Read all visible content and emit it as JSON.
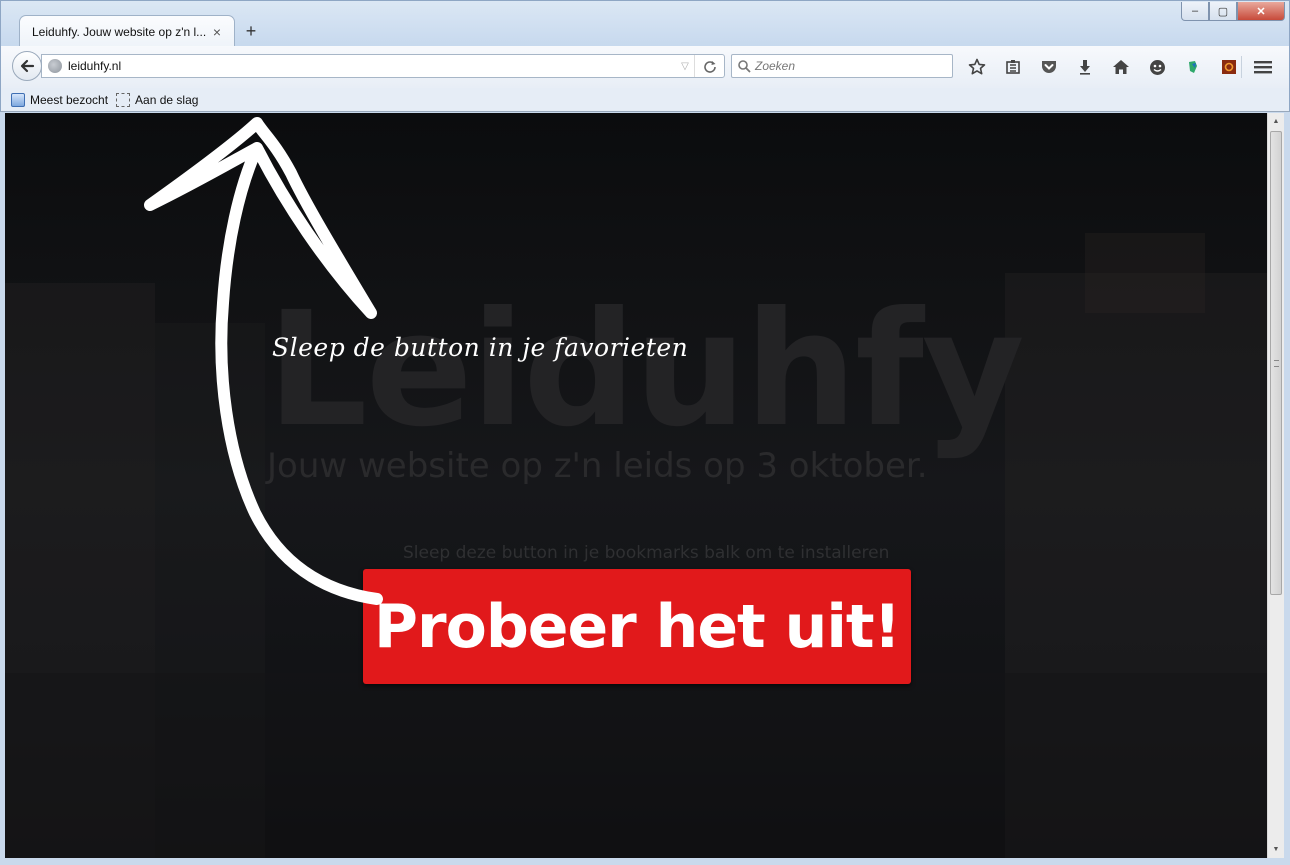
{
  "window": {
    "tab_title": "Leiduhfy. Jouw website op z'n l...",
    "tab_close": "×",
    "new_tab": "+",
    "controls": {
      "minimize": "‒",
      "maximize": "▢",
      "close": "✕"
    }
  },
  "navbar": {
    "url": "leiduhfy.nl",
    "url_dropdown": "▽",
    "search_placeholder": "Zoeken",
    "icons": [
      "bookmark-star-icon",
      "reading-list-icon",
      "pocket-icon",
      "download-icon",
      "home-icon",
      "emoji-icon",
      "extension-green-icon",
      "extension-orange-icon",
      "hamburger-menu-icon"
    ]
  },
  "bookmarks": {
    "items": [
      {
        "label": "Meest bezocht",
        "icon": "most-visited-icon"
      },
      {
        "label": "Aan de slag",
        "icon": "getting-started-icon"
      }
    ]
  },
  "page": {
    "logo": "Leiduhfy",
    "tagline": "Jouw website op z'n leids op 3 oktober.",
    "instruction": "Sleep deze button in je bookmarks balk om te installeren",
    "cta_label": "Probeer het uit!",
    "handwritten_note": "Sleep de button in je favorieten"
  },
  "colors": {
    "cta_red": "#e1191b",
    "background": "#111214",
    "chrome": "#c9d9ec"
  },
  "scrollbar": {
    "up": "▲",
    "down": "▼"
  }
}
